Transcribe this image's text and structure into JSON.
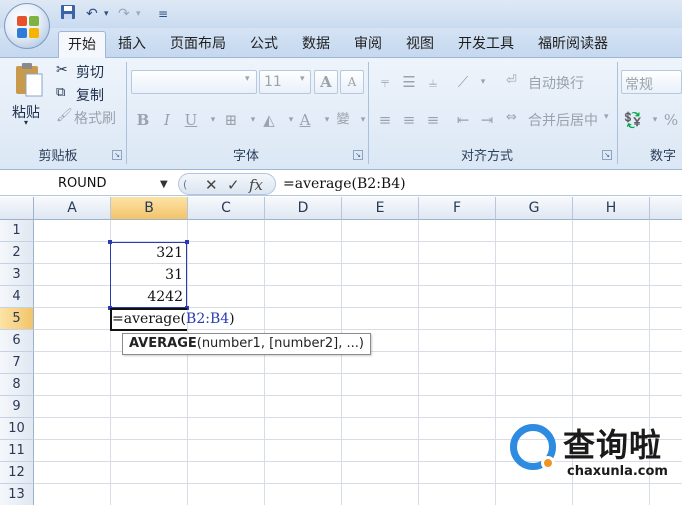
{
  "ribbon_tabs": [
    "开始",
    "插入",
    "页面布局",
    "公式",
    "数据",
    "审阅",
    "视图",
    "开发工具",
    "福昕阅读器"
  ],
  "clipboard": {
    "paste_label": "粘贴",
    "cut_label": "剪切",
    "copy_label": "复制",
    "format_painter_label": "格式刷",
    "group_label": "剪贴板"
  },
  "font": {
    "font_size": "11",
    "grow_label": "A",
    "shrink_label": "A",
    "bold_label": "B",
    "italic_label": "I",
    "underline_label": "U",
    "font_color_label": "A",
    "group_label": "字体"
  },
  "alignment": {
    "wrap_text_label": "自动换行",
    "merge_center_label": "合并后居中",
    "group_label": "对齐方式"
  },
  "number": {
    "format_value": "常规",
    "percent_label": "%",
    "group_label": "数字"
  },
  "formula_bar": {
    "name_box": "ROUND",
    "cancel_symbol": "✕",
    "enter_symbol": "✓",
    "fx_symbol": "fx",
    "formula": "=average(B2:B4)"
  },
  "grid": {
    "columns": [
      "A",
      "B",
      "C",
      "D",
      "E",
      "F",
      "G",
      "H"
    ],
    "rows": [
      "1",
      "2",
      "3",
      "4",
      "5",
      "6",
      "7",
      "8",
      "9",
      "10",
      "11",
      "12",
      "13"
    ],
    "cells": {
      "B2": "321",
      "B3": "31",
      "B4": "4242"
    },
    "edit": {
      "prefix": "=average(",
      "ref": "B2:B4",
      "suffix": ")"
    },
    "tooltip": {
      "func": "AVERAGE",
      "args": "(number1, [number2], ...)"
    }
  },
  "watermark": {
    "cn": "查询啦",
    "en": "chaxunla.com"
  },
  "colors": {
    "ribbon_bg": "#dbe7f5",
    "selection_header": "#f3c46a",
    "range_border": "#2a3bb0",
    "watermark_blue": "#2d8be0",
    "watermark_orange": "#f29423"
  }
}
